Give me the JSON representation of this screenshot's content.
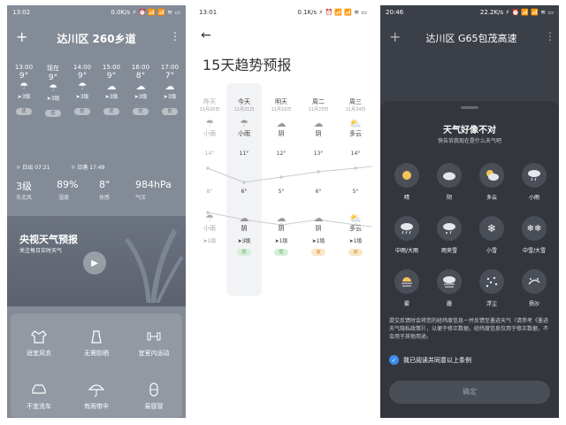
{
  "panel1": {
    "status_time": "13:02",
    "status_right": "0.0K/s ⚡ ⏰ 📶 📶 ≋ ▭",
    "add_icon": "+",
    "location": "达川区 260乡道",
    "more_icon": "⋮",
    "hourly": [
      {
        "time": "13:00",
        "temp": "9°",
        "wind": "3级",
        "aqi": "优"
      },
      {
        "time": "现在",
        "temp": "9°",
        "wind": "3级",
        "aqi": "优"
      },
      {
        "time": "14:00",
        "temp": "9°",
        "wind": "3级",
        "aqi": "优"
      },
      {
        "time": "15:00",
        "temp": "9°",
        "wind": "3级",
        "aqi": "优"
      },
      {
        "time": "16:00",
        "temp": "8°",
        "wind": "3级",
        "aqi": "优"
      },
      {
        "time": "17:00",
        "temp": "7°",
        "wind": "3级",
        "aqi": "优"
      }
    ],
    "sunrise": "日出 07:21",
    "sunset": "日落 17:49",
    "stats": [
      {
        "value": "3级",
        "label": "东北风"
      },
      {
        "value": "89%",
        "label": "湿度"
      },
      {
        "value": "8°",
        "label": "体感"
      },
      {
        "value": "984hPa",
        "label": "气压"
      }
    ],
    "video_title": "央视天气预报",
    "video_sub": "关注每日实时天气",
    "life": [
      {
        "label": "适宜风衣",
        "icon": "coat-icon"
      },
      {
        "label": "无需防晒",
        "icon": "sunscreen-icon"
      },
      {
        "label": "宜室内运动",
        "icon": "dumbbell-icon"
      },
      {
        "label": "不宜洗车",
        "icon": "car-icon"
      },
      {
        "label": "有雨带伞",
        "icon": "umbrella-icon"
      },
      {
        "label": "易感冒",
        "icon": "capsule-icon"
      }
    ]
  },
  "panel2": {
    "status_time": "13:01",
    "status_right": "0.1K/s ⚡ ⏰ 📶 📶 ≋ ▭",
    "back_icon": "←",
    "title": "15天趋势预报",
    "days": [
      {
        "day": "昨天",
        "date": "11月20日",
        "cond_top": "小雨",
        "high": "14°",
        "low": "8°",
        "cond_bottom": "小雨",
        "wind": "1级",
        "aqi": ""
      },
      {
        "day": "今天",
        "date": "11月21日",
        "cond_top": "小雨",
        "high": "11°",
        "low": "6°",
        "cond_bottom": "阴",
        "wind": "3级",
        "aqi": "优"
      },
      {
        "day": "明天",
        "date": "11月22日",
        "cond_top": "阴",
        "high": "12°",
        "low": "5°",
        "cond_bottom": "阴",
        "wind": "1级",
        "aqi": "优"
      },
      {
        "day": "周二",
        "date": "11月23日",
        "cond_top": "阴",
        "high": "13°",
        "low": "6°",
        "cond_bottom": "阴",
        "wind": "1级",
        "aqi": "良"
      },
      {
        "day": "周三",
        "date": "11月24日",
        "cond_top": "多云",
        "high": "14°",
        "low": "5°",
        "cond_bottom": "多云",
        "wind": "1级",
        "aqi": "良"
      }
    ],
    "colors": {
      "aqi_good": "#d6f0d8",
      "aqi_good_text": "#4a9a52",
      "aqi_fair": "#fbe7c6",
      "aqi_fair_text": "#c98a2a"
    }
  },
  "panel3": {
    "status_time": "20:46",
    "status_right": "22.2K/s ⚡ ⏰ 📶 📶 ≋ ▭",
    "add_icon": "+",
    "location": "达川区 G65包茂高速",
    "more_icon": "⋮",
    "dialog_title": "天气好像不对",
    "dialog_sub": "快告诉我现在是什么天气吧",
    "options": [
      {
        "label": "晴",
        "icon": "sun-icon"
      },
      {
        "label": "阴",
        "icon": "cloud-icon"
      },
      {
        "label": "多云",
        "icon": "partly-cloudy-icon"
      },
      {
        "label": "小雨",
        "icon": "light-rain-icon"
      },
      {
        "label": "中雨/大雨",
        "icon": "heavy-rain-icon"
      },
      {
        "label": "雨夹雪",
        "icon": "sleet-icon"
      },
      {
        "label": "小雪",
        "icon": "snowflake-icon"
      },
      {
        "label": "中雪/大雪",
        "icon": "heavy-snow-icon"
      },
      {
        "label": "雾",
        "icon": "fog-icon"
      },
      {
        "label": "霾",
        "icon": "haze-icon"
      },
      {
        "label": "浮尘",
        "icon": "dust-icon"
      },
      {
        "label": "扬沙",
        "icon": "sand-icon"
      }
    ],
    "notice": "提交反馈时会将您的经纬度信息一并反馈至墨迹天气（请参考《墨迹天气隐私政策》），以便于修正数据，经纬度信息仅用于修正数据，不会用于其他用途。",
    "agree_label": "我已阅读并同意以上条例",
    "confirm_label": "确定",
    "colors": {
      "accent": "#3a8df0"
    }
  }
}
